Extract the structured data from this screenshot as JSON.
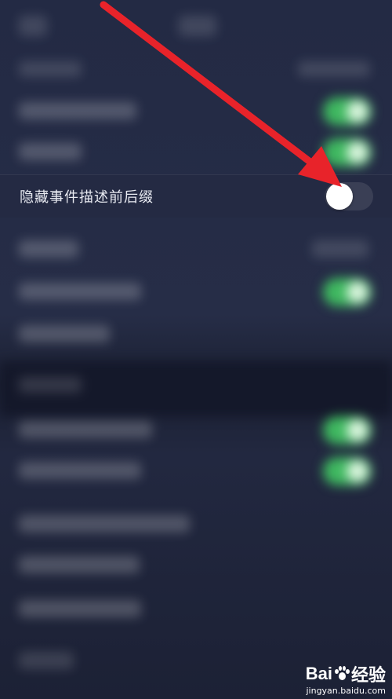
{
  "setting": {
    "label": "隐藏事件描述前后缀",
    "enabled": false
  },
  "colors": {
    "arrow": "#e8232a",
    "toggle_on": "#3fb860",
    "toggle_off": "#3a3f55"
  },
  "watermark": {
    "logo_left": "Bai",
    "logo_right": "经验",
    "url": "jingyan.baidu.com"
  }
}
